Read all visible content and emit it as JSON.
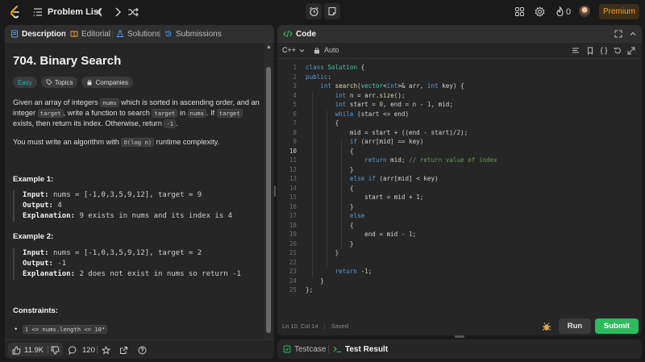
{
  "topbar": {
    "title": "Problem List",
    "streak_count": "0",
    "premium_label": "Premium",
    "icons": [
      "logo-icon",
      "list-icon",
      "chevron-left-icon",
      "chevron-right-icon",
      "shuffle-icon",
      "alarm-icon",
      "note-icon",
      "grid-icon",
      "gear-icon",
      "fire-icon",
      "avatar"
    ]
  },
  "left": {
    "tabs": [
      "Description",
      "Editorial",
      "Solutions",
      "Submissions"
    ],
    "title": "704. Binary Search",
    "chips": {
      "difficulty": "Easy",
      "topics": "Topics",
      "companies": "Companies"
    },
    "para1": {
      "t1": "Given an array of integers ",
      "c1": "nums",
      "t2": " which is sorted in ascending order, and an integer ",
      "c2": "target",
      "t3": ", write a function to search ",
      "c3": "target",
      "t4": " in ",
      "c4": "nums",
      "t5": ". If ",
      "c5": "target",
      "t6": " exists, then return its index. Otherwise, return ",
      "c6": "-1",
      "t7": "."
    },
    "para2": {
      "t1": "You must write an algorithm with ",
      "c1": "O(log n)",
      "t2": " runtime complexity."
    },
    "example1": {
      "title": "Example 1:",
      "input_label": "Input:",
      "input": "nums = [-1,0,3,5,9,12], target = 9",
      "output_label": "Output:",
      "output": "4",
      "expl_label": "Explanation:",
      "expl": "9 exists in nums and its index is 4"
    },
    "example2": {
      "title": "Example 2:",
      "input_label": "Input:",
      "input": "nums = [-1,0,3,5,9,12], target = 2",
      "output_label": "Output:",
      "output": "-1",
      "expl_label": "Explanation:",
      "expl": "2 does not exist in nums so return -1"
    },
    "constraints_title": "Constraints:",
    "constraint1": "1 <= nums.length <= 10⁴",
    "footer": {
      "likes": "11.9K",
      "comments": "120"
    }
  },
  "code": {
    "header": "Code",
    "language": "C++",
    "auto_label": "Auto",
    "lines": [
      "class Solution {",
      "public:",
      "    int search(vector<int>& arr, int key) {",
      "        int n = arr.size();",
      "        int start = 0, end = n - 1, mid;",
      "        while (start <= end)",
      "        {",
      "            mid = start + ((end - start)/2);",
      "            if (arr[mid] == key)",
      "            {",
      "                return mid; // return value of index",
      "            }",
      "            else if (arr[mid] < key)",
      "            {",
      "                start = mid + 1;",
      "            }",
      "            else",
      "            {",
      "                end = mid - 1;",
      "            }",
      "        }",
      "",
      "        return -1;",
      "    }",
      "};"
    ],
    "current_line": 10,
    "status_pos": "Ln 10, Col 14",
    "status_saved": "Saved",
    "run_label": "Run",
    "submit_label": "Submit"
  },
  "result": {
    "testcase": "Testcase",
    "test_result": "Test Result"
  },
  "colors": {
    "accent": "#ffa116",
    "submit": "#2cbb5d",
    "easy": "#1cbaba",
    "bg": "#1a1a1a",
    "panel": "#262626"
  }
}
